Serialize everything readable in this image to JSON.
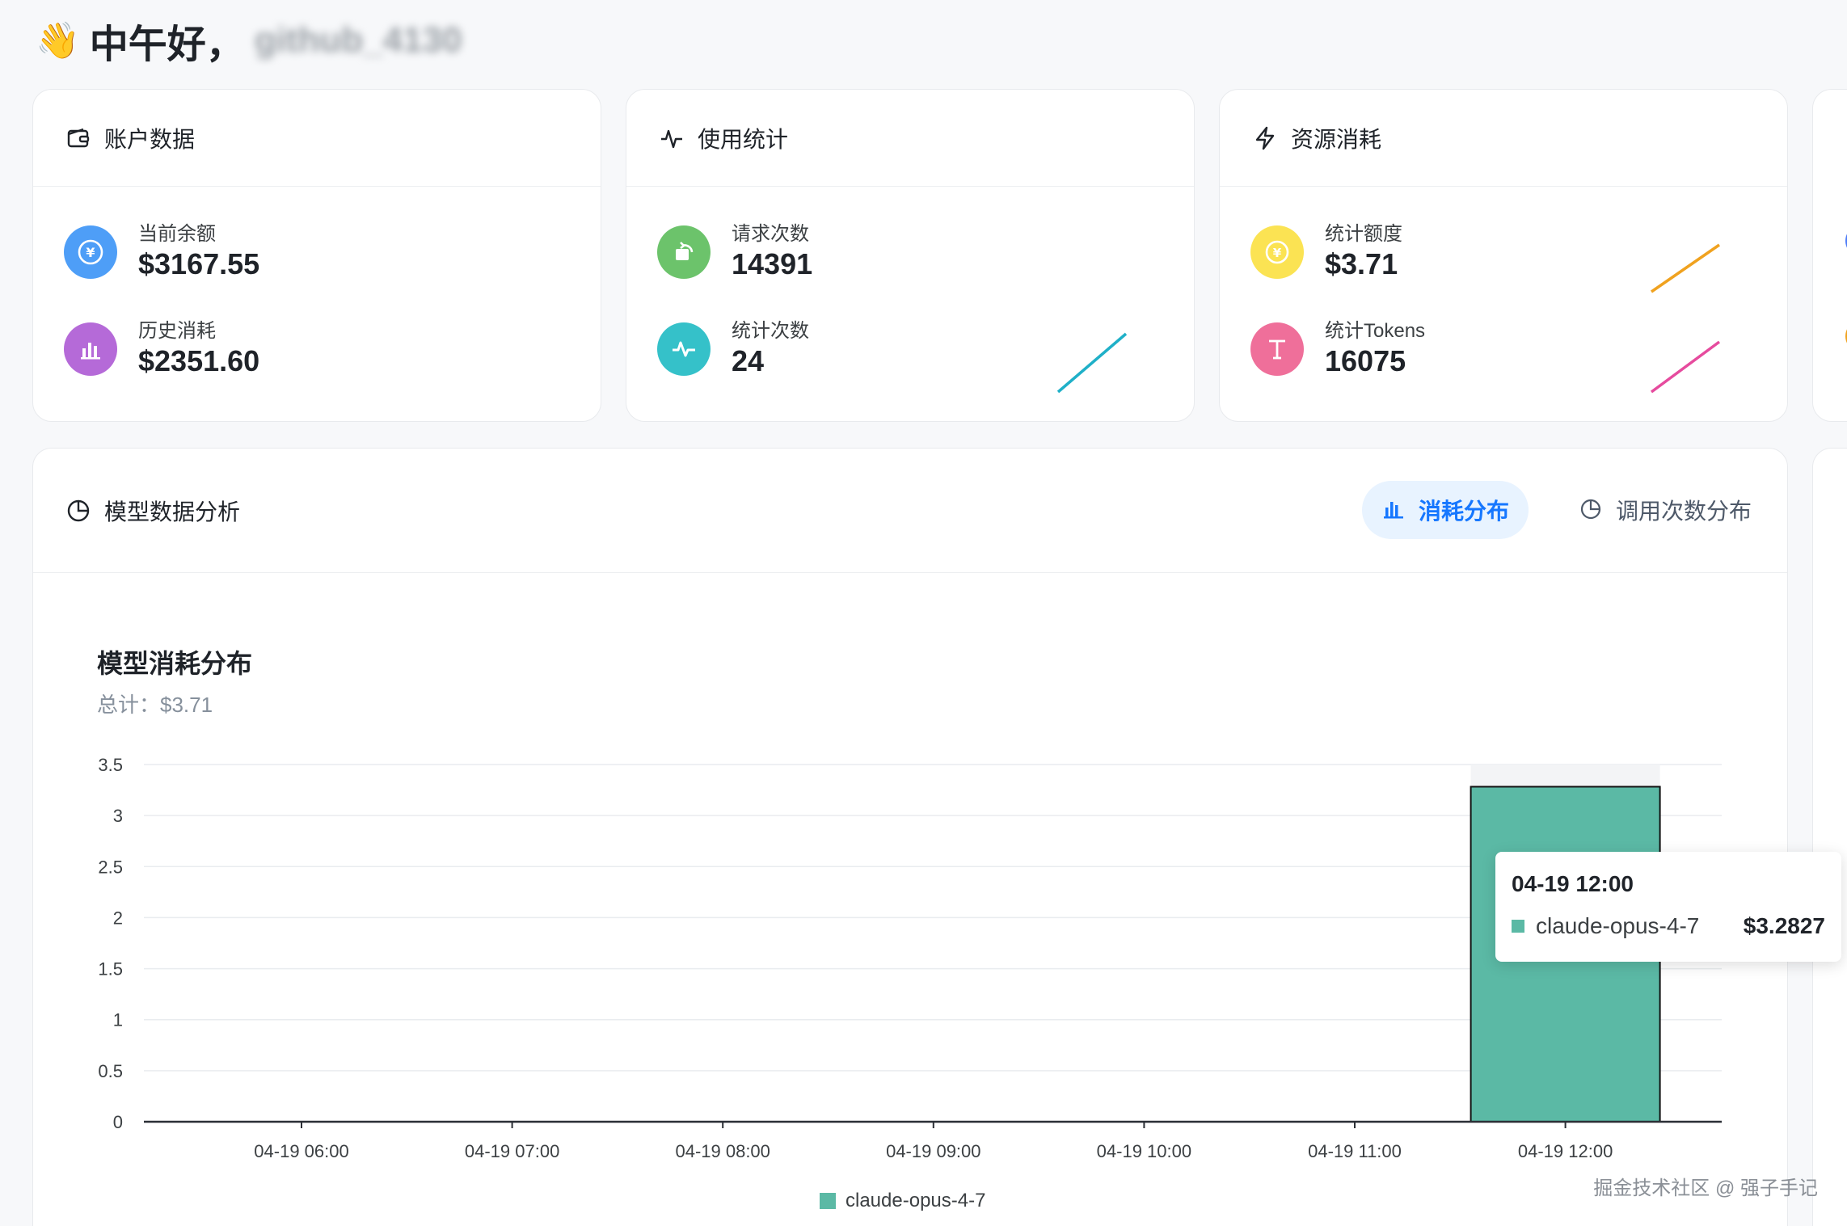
{
  "greeting": {
    "wave": "👋",
    "text": "中午好，",
    "username": "github_4130"
  },
  "account_card": {
    "title": "账户数据",
    "items": [
      {
        "label": "当前余额",
        "value": "$3167.55"
      },
      {
        "label": "历史消耗",
        "value": "$2351.60"
      }
    ]
  },
  "usage_card": {
    "title": "使用统计",
    "items": [
      {
        "label": "请求次数",
        "value": "14391"
      },
      {
        "label": "统计次数",
        "value": "24"
      }
    ]
  },
  "resource_card": {
    "title": "资源消耗",
    "items": [
      {
        "label": "统计额度",
        "value": "$3.71"
      },
      {
        "label": "统计Tokens",
        "value": "16075"
      }
    ]
  },
  "analysis": {
    "title": "模型数据分析",
    "tabs": [
      {
        "label": "消耗分布",
        "active": true
      },
      {
        "label": "调用次数分布",
        "active": false
      }
    ]
  },
  "colors": {
    "blue_icon": "#4e9ef7",
    "purple_icon": "#b56ad8",
    "green_icon": "#6cc36b",
    "cyan_icon": "#35c1c9",
    "yellow_icon": "#fbe353",
    "pink_icon": "#ef6f9a",
    "bar": "#5bb9a5",
    "tab_active": "#1677ff"
  },
  "chart_data": {
    "type": "bar",
    "title": "模型消耗分布",
    "subtitle": "总计：$3.71",
    "categories": [
      "04-19 06:00",
      "04-19 07:00",
      "04-19 08:00",
      "04-19 09:00",
      "04-19 10:00",
      "04-19 11:00",
      "04-19 12:00"
    ],
    "series": [
      {
        "name": "claude-opus-4-7",
        "values": [
          0,
          0,
          0,
          0,
          0,
          0,
          3.2827
        ]
      }
    ],
    "y_ticks": [
      "0",
      "0.5",
      "1",
      "1.5",
      "2",
      "2.5",
      "3",
      "3.5"
    ],
    "ylim": [
      0,
      3.5
    ],
    "grid": true,
    "legend": "bottom",
    "tooltip": {
      "title": "04-19 12:00",
      "series": "claude-opus-4-7",
      "value": "$3.2827"
    }
  },
  "watermark": "掘金技术社区 @ 强子手记"
}
